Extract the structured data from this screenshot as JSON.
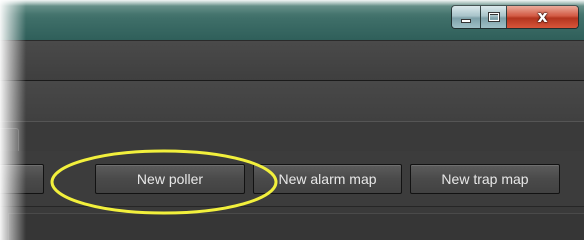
{
  "window": {
    "controls": {
      "minimize_icon": "minimize-icon",
      "maximize_icon": "maximize-icon",
      "close_icon": "close-icon",
      "close_glyph": "x"
    }
  },
  "toolbar": {
    "buttons": [
      {
        "label": ""
      },
      {
        "label": "New poller"
      },
      {
        "label": "New alarm map"
      },
      {
        "label": "New trap map"
      }
    ]
  },
  "annotation": {
    "highlight_color": "#f2f03c"
  },
  "colors": {
    "titlebar": "#3f6f69",
    "panel": "#3c3c3c",
    "button_text": "#e8e8e8",
    "close_button": "#c9452c"
  }
}
